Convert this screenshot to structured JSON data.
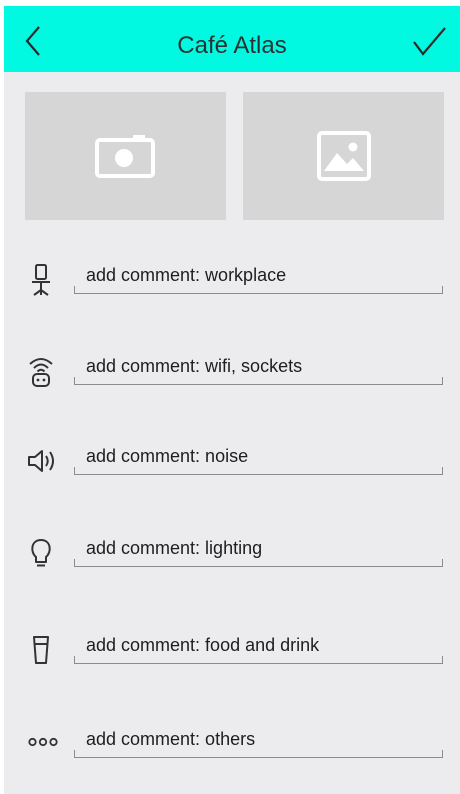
{
  "appbar": {
    "title": "Café Atlas",
    "back_icon": "chevron-left-icon",
    "confirm_icon": "checkmark-icon"
  },
  "photo_tiles": {
    "camera_icon": "camera-icon",
    "gallery_icon": "image-icon"
  },
  "comments": [
    {
      "icon": "office-chair-icon",
      "text": "add comment: workplace"
    },
    {
      "icon": "wifi-socket-icon",
      "text": "add comment: wifi, sockets"
    },
    {
      "icon": "speaker-icon",
      "text": "add comment: noise"
    },
    {
      "icon": "lightbulb-icon",
      "text": "add comment: lighting"
    },
    {
      "icon": "cup-icon",
      "text": "add comment: food and drink"
    },
    {
      "icon": "more-dots-icon",
      "text": "add comment: others"
    }
  ],
  "colors": {
    "appbar": "#00f9e0",
    "background": "#ececee",
    "tile": "#d6d6d6"
  }
}
